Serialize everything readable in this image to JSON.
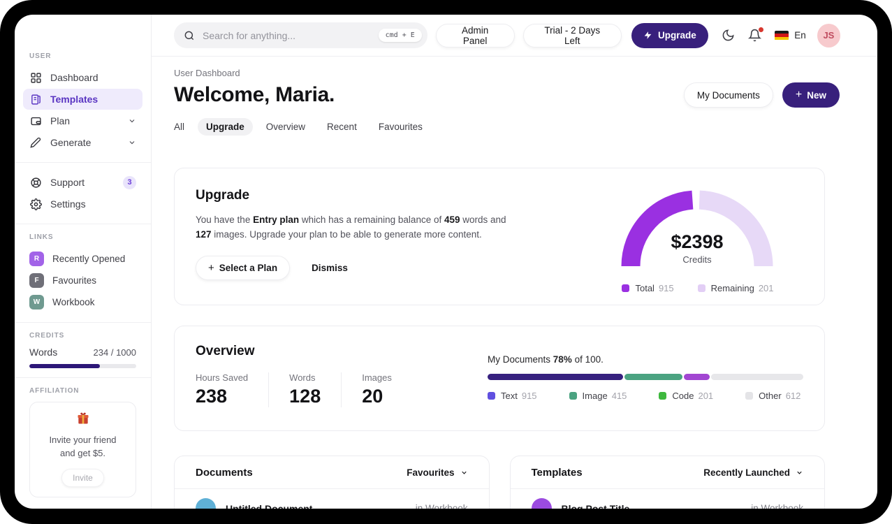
{
  "icons": {
    "plus": "+"
  },
  "topbar": {
    "search_placeholder": "Search for anything...",
    "shortcut": "cmd + E",
    "admin_panel_label": "Admin Panel",
    "trial_label": "Trial - 2 Days Left",
    "upgrade_label": "Upgrade",
    "language_label": "En",
    "avatar_initials": "JS"
  },
  "sidebar": {
    "section_user": "USER",
    "nav": [
      {
        "label": "Dashboard"
      },
      {
        "label": "Templates"
      },
      {
        "label": "Plan"
      },
      {
        "label": "Generate"
      }
    ],
    "support_label": "Support",
    "support_badge": "3",
    "settings_label": "Settings",
    "section_links": "LINKS",
    "links": [
      {
        "initial": "R",
        "label": "Recently Opened",
        "color": "#a263e8"
      },
      {
        "initial": "F",
        "label": "Favourites",
        "color": "#6f6f78"
      },
      {
        "initial": "W",
        "label": "Workbook",
        "color": "#6f9a90"
      }
    ],
    "section_credits": "CREDITS",
    "credits": {
      "label": "Words",
      "value": "234 / 1000",
      "percent": 66,
      "fill_color": "#2d1778"
    },
    "section_affiliation": "AFFILIATION",
    "affiliation": {
      "line1": "Invite your friend",
      "line2": "and get $5.",
      "button_label": "Invite"
    }
  },
  "header": {
    "breadcrumb": "User Dashboard",
    "title": "Welcome, Maria.",
    "my_documents_label": "My Documents",
    "new_label": "New",
    "tabs": [
      {
        "label": "All"
      },
      {
        "label": "Upgrade"
      },
      {
        "label": "Overview"
      },
      {
        "label": "Recent"
      },
      {
        "label": "Favourites"
      }
    ]
  },
  "upgrade_card": {
    "title": "Upgrade",
    "body": {
      "t1": "You have the ",
      "b1": "Entry plan",
      "t2": " which has a remaining balance of ",
      "b2": "459",
      "t3": " words and ",
      "b3": "127",
      "t4": " images. Upgrade your plan to be able to generate more content."
    },
    "select_plan_label": "Select a Plan",
    "dismiss_label": "Dismiss",
    "gauge": {
      "value": "$2398",
      "label": "Credits",
      "arc_main_color": "#9a30e1",
      "arc_rest_color": "#e7d9f7",
      "legend": [
        {
          "label": "Total",
          "value": "915",
          "color": "#9a30e1"
        },
        {
          "label": "Remaining",
          "value": "201",
          "color": "#e2cef5"
        }
      ]
    }
  },
  "overview_card": {
    "title": "Overview",
    "stats": [
      {
        "label": "Hours Saved",
        "value": "238"
      },
      {
        "label": "Words",
        "value": "128"
      },
      {
        "label": "Images",
        "value": "20"
      }
    ],
    "progress": {
      "t1": "My Documents ",
      "bold": "78%",
      "t2": " of 100."
    },
    "bar_segments": [
      {
        "percent": 43.5,
        "color": "#37217f"
      },
      {
        "percent": 18.5,
        "color": "#4ba381"
      },
      {
        "percent": 8.5,
        "color": "#a246d2"
      },
      {
        "percent": 29.5,
        "color": "#e7e7ea"
      }
    ],
    "legend": [
      {
        "label": "Text",
        "value": "915",
        "color": "#6050e0"
      },
      {
        "label": "Image",
        "value": "415",
        "color": "#4ba381"
      },
      {
        "label": "Code",
        "value": "201",
        "color": "#3eb83e"
      },
      {
        "label": "Other",
        "value": "612",
        "color": "#e4e4e7"
      }
    ]
  },
  "documents_card": {
    "title": "Documents",
    "filter_label": "Favourites",
    "rows": [
      {
        "title": "Untitled Document",
        "location": "in Workbook",
        "avatar_color": "#5fb0d6"
      }
    ]
  },
  "templates_card": {
    "title": "Templates",
    "filter_label": "Recently Launched",
    "rows": [
      {
        "title": "Blog Post Title",
        "location": "in Workbook",
        "avatar_color": "#9b4be0"
      }
    ]
  }
}
